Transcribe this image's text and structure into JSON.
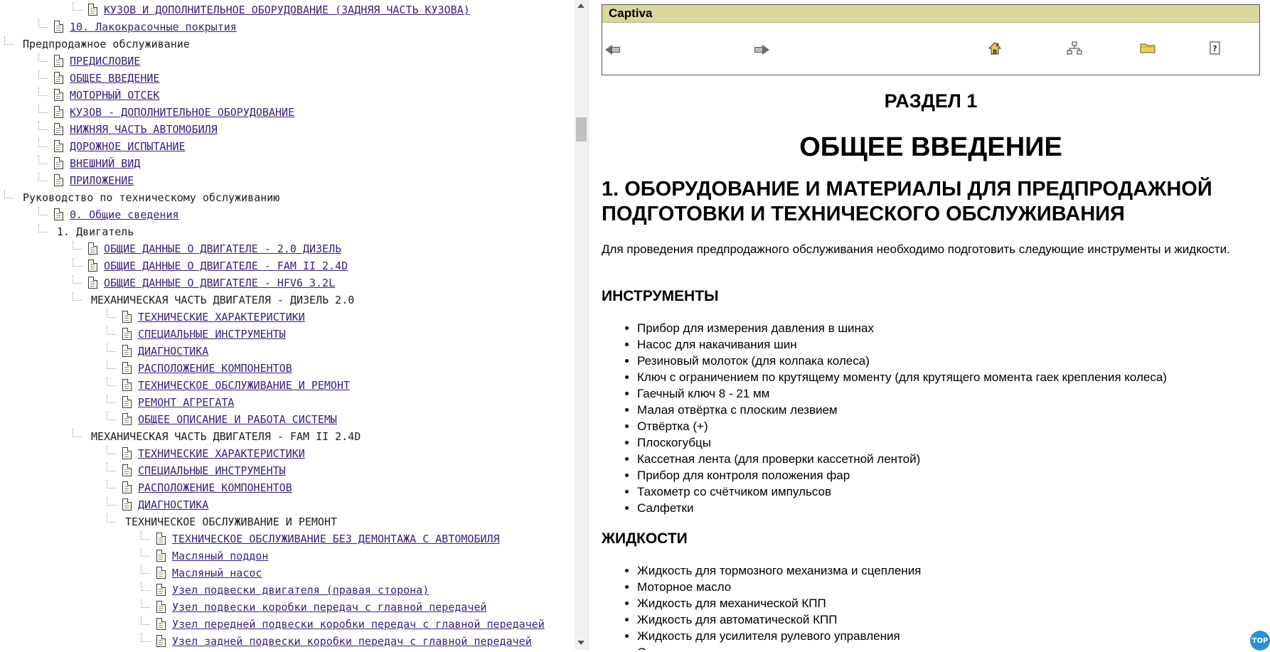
{
  "tree": {
    "rows": [
      {
        "label": "КУЗОВ И ДОПОЛНИТЕЛЬНОЕ ОБОРУДОВАНИЕ (ЗАДНЯЯ ЧАСТЬ КУЗОВА)",
        "level": 2,
        "icon": "page-icon",
        "link": true
      },
      {
        "label": "10. Лакокрасочные покрытия",
        "level": 1,
        "icon": "page-icon",
        "link": true
      },
      {
        "label": "Предпродажное обслуживание",
        "level": 0,
        "icon": "",
        "link": false
      },
      {
        "label": "ПРЕДИСЛОВИЕ",
        "level": 1,
        "icon": "page-icon",
        "link": true
      },
      {
        "label": "ОБЩЕЕ ВВЕДЕНИЕ",
        "level": 1,
        "icon": "page-icon",
        "link": true
      },
      {
        "label": "МОТОРНЫЙ ОТСЕК",
        "level": 1,
        "icon": "page-icon",
        "link": true
      },
      {
        "label": "КУЗОВ - ДОПОЛНИТЕЛЬНОЕ ОБОРУДОВАНИЕ",
        "level": 1,
        "icon": "page-icon",
        "link": true
      },
      {
        "label": "НИЖНЯЯ ЧАСТЬ АВТОМОБИЛЯ",
        "level": 1,
        "icon": "page-icon",
        "link": true
      },
      {
        "label": "ДОРОЖНОЕ ИСПЫТАНИЕ",
        "level": 1,
        "icon": "page-icon",
        "link": true
      },
      {
        "label": "ВНЕШНИЙ ВИД",
        "level": 1,
        "icon": "page-icon",
        "link": true
      },
      {
        "label": "ПРИЛОЖЕНИЕ",
        "level": 1,
        "icon": "page-icon",
        "link": true
      },
      {
        "label": "Руководство по техническому обслуживанию",
        "level": 0,
        "icon": "",
        "link": false
      },
      {
        "label": "0. Общие сведения",
        "level": 1,
        "icon": "page-icon",
        "link": true
      },
      {
        "label": "1. Двигатель",
        "level": 1,
        "icon": "",
        "link": false
      },
      {
        "label": "ОБЩИЕ ДАННЫЕ О ДВИГАТЕЛЕ - 2.0 ДИЗЕЛЬ",
        "level": 2,
        "icon": "page-icon",
        "link": true
      },
      {
        "label": "ОБЩИЕ ДАННЫЕ О ДВИГАТЕЛЕ - FAM II 2.4D",
        "level": 2,
        "icon": "page-icon",
        "link": true
      },
      {
        "label": "ОБЩИЕ ДАННЫЕ О ДВИГАТЕЛЕ - HFV6 3.2L",
        "level": 2,
        "icon": "page-icon",
        "link": true
      },
      {
        "label": "МЕХАНИЧЕСКАЯ ЧАСТЬ ДВИГАТЕЛЯ - ДИЗЕЛЬ 2.0",
        "level": 2,
        "icon": "",
        "link": false
      },
      {
        "label": "ТЕХНИЧЕСКИЕ ХАРАКТЕРИСТИКИ",
        "level": 3,
        "icon": "page-icon",
        "link": true
      },
      {
        "label": "СПЕЦИАЛЬНЫЕ ИНСТРУМЕНТЫ",
        "level": 3,
        "icon": "page-icon",
        "link": true
      },
      {
        "label": "ДИАГНОСТИКА",
        "level": 3,
        "icon": "page-icon",
        "link": true
      },
      {
        "label": "РАСПОЛОЖЕНИЕ КОМПОНЕНТОВ",
        "level": 3,
        "icon": "page-icon",
        "link": true
      },
      {
        "label": "ТЕХНИЧЕСКОЕ ОБСЛУЖИВАНИЕ И РЕМОНТ",
        "level": 3,
        "icon": "page-icon",
        "link": true
      },
      {
        "label": "РЕМОНТ АГРЕГАТА",
        "level": 3,
        "icon": "page-icon",
        "link": true
      },
      {
        "label": "ОБЩЕЕ ОПИСАНИЕ И РАБОТА СИСТЕМЫ",
        "level": 3,
        "icon": "page-icon",
        "link": true
      },
      {
        "label": "МЕХАНИЧЕСКАЯ ЧАСТЬ ДВИГАТЕЛЯ - FAM II 2.4D",
        "level": 2,
        "icon": "",
        "link": false
      },
      {
        "label": "ТЕХНИЧЕСКИЕ ХАРАКТЕРИСТИКИ",
        "level": 3,
        "icon": "page-icon",
        "link": true
      },
      {
        "label": "СПЕЦИАЛЬНЫЕ ИНСТРУМЕНТЫ",
        "level": 3,
        "icon": "page-icon",
        "link": true
      },
      {
        "label": "РАСПОЛОЖЕНИЕ КОМПОНЕНТОВ",
        "level": 3,
        "icon": "page-icon",
        "link": true
      },
      {
        "label": "ДИАГНОСТИКА",
        "level": 3,
        "icon": "page-icon",
        "link": true
      },
      {
        "label": "ТЕХНИЧЕСКОЕ ОБСЛУЖИВАНИЕ И РЕМОНТ",
        "level": 3,
        "icon": "",
        "link": false
      },
      {
        "label": "ТЕХНИЧЕСКОЕ ОБСЛУЖИВАНИЕ БЕЗ ДЕМОНТАЖА С АВТОМОБИЛЯ",
        "level": 4,
        "icon": "page-icon",
        "link": true
      },
      {
        "label": "Масляный поддон",
        "level": 4,
        "icon": "page-icon",
        "link": true
      },
      {
        "label": "Масляный насос",
        "level": 4,
        "icon": "page-icon",
        "link": true
      },
      {
        "label": "Узел подвески двигателя (правая сторона)",
        "level": 4,
        "icon": "page-icon",
        "link": true
      },
      {
        "label": "Узел подвески коробки передач с главной передачей",
        "level": 4,
        "icon": "page-icon",
        "link": true
      },
      {
        "label": "Узел передней подвески коробки передач с главной передачей",
        "level": 4,
        "icon": "page-icon",
        "link": true
      },
      {
        "label": "Узел задней подвески коробки передач с главной передачей",
        "level": 4,
        "icon": "page-icon",
        "link": true
      }
    ]
  },
  "nav": {
    "title": "Captiva",
    "buttons": [
      {
        "name": "back-button",
        "icon": "back-arrow-icon"
      },
      {
        "name": "forward-button",
        "icon": "forward-arrow-icon"
      },
      {
        "name": "home-button",
        "icon": "home-icon"
      },
      {
        "name": "contents-button",
        "icon": "sitemap-icon"
      },
      {
        "name": "index-button",
        "icon": "folder-icon"
      },
      {
        "name": "help-button",
        "icon": "help-icon"
      }
    ]
  },
  "document": {
    "section": "РАЗДЕЛ 1",
    "title": "ОБЩЕЕ ВВЕДЕНИЕ",
    "h1": "1. ОБОРУДОВАНИЕ И МАТЕРИАЛЫ ДЛЯ ПРЕДПРОДАЖНОЙ ПОДГОТОВКИ И ТЕХНИЧЕСКОГО ОБСЛУЖИВАНИЯ",
    "intro": "Для проведения предпродажного обслуживания необходимо подготовить следующие инструменты и жидкости.",
    "tools_heading": "ИНСТРУМЕНТЫ",
    "tools": [
      "Прибор для измерения давления в шинах",
      "Насос для накачивания шин",
      "Резиновый молоток (для колпака колеса)",
      "Ключ с ограничением по крутящему моменту (для крутящего момента гаек крепления колеса)",
      "Гаечный ключ 8 - 21 мм",
      "Малая отвёртка с плоским лезвием",
      "Отвёртка (+)",
      "Плоскогубцы",
      "Кассетная лента (для проверки кассетной лентой)",
      "Прибор для контроля положения фар",
      "Тахометр со счётчиком импульсов",
      "Салфетки"
    ],
    "fluids_heading": "ЖИДКОСТИ",
    "fluids": [
      "Жидкость для тормозного механизма и сцепления",
      "Моторное масло",
      "Жидкость для механической КПП",
      "Жидкость для автоматической КПП",
      "Жидкость для усилителя рулевого управления",
      "Охлаждающая жидкость"
    ]
  },
  "scroll_top_label": "TOP",
  "colors": {
    "link": "#3c1f7a",
    "nav_bar_bg": "#d9d79e",
    "top_button": "#2b8fd6"
  }
}
